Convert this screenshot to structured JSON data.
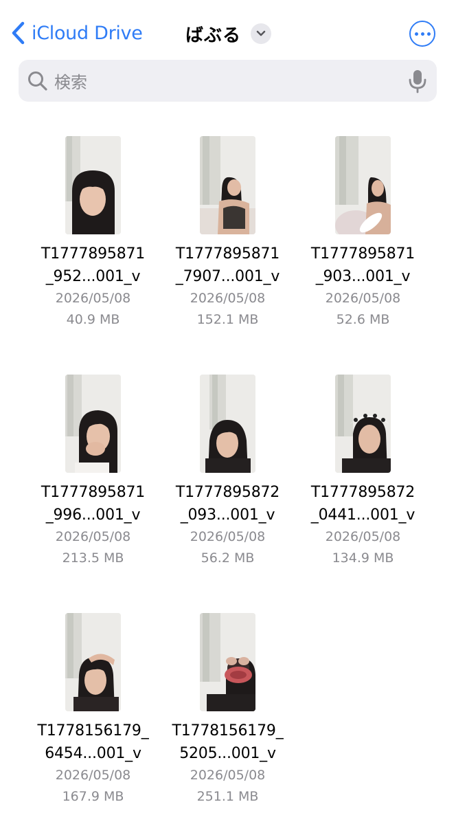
{
  "nav": {
    "back_label": "iCloud Drive",
    "title": "ばぶる"
  },
  "search": {
    "placeholder": "検索"
  },
  "files": [
    {
      "name_line1": "T1777895871",
      "name_line2": "_952...001_v",
      "date": "2026/05/08",
      "size": "40.9 MB"
    },
    {
      "name_line1": "T1777895871",
      "name_line2": "_7907...001_v",
      "date": "2026/05/08",
      "size": "152.1 MB"
    },
    {
      "name_line1": "T1777895871",
      "name_line2": "_903...001_v",
      "date": "2026/05/08",
      "size": "52.6 MB"
    },
    {
      "name_line1": "T1777895871",
      "name_line2": "_996...001_v",
      "date": "2026/05/08",
      "size": "213.5 MB"
    },
    {
      "name_line1": "T1777895872",
      "name_line2": "_093...001_v",
      "date": "2026/05/08",
      "size": "56.2 MB"
    },
    {
      "name_line1": "T1777895872",
      "name_line2": "_0441...001_v",
      "date": "2026/05/08",
      "size": "134.9 MB"
    },
    {
      "name_line1": "T1778156179_",
      "name_line2": "6454...001_v",
      "date": "2026/05/08",
      "size": "167.9 MB"
    },
    {
      "name_line1": "T1778156179_",
      "name_line2": "5205...001_v",
      "date": "2026/05/08",
      "size": "251.1 MB"
    }
  ],
  "colors": {
    "accent": "#2f7cf6",
    "secondary_text": "#8a8a8f",
    "search_bg": "#efeff3"
  }
}
